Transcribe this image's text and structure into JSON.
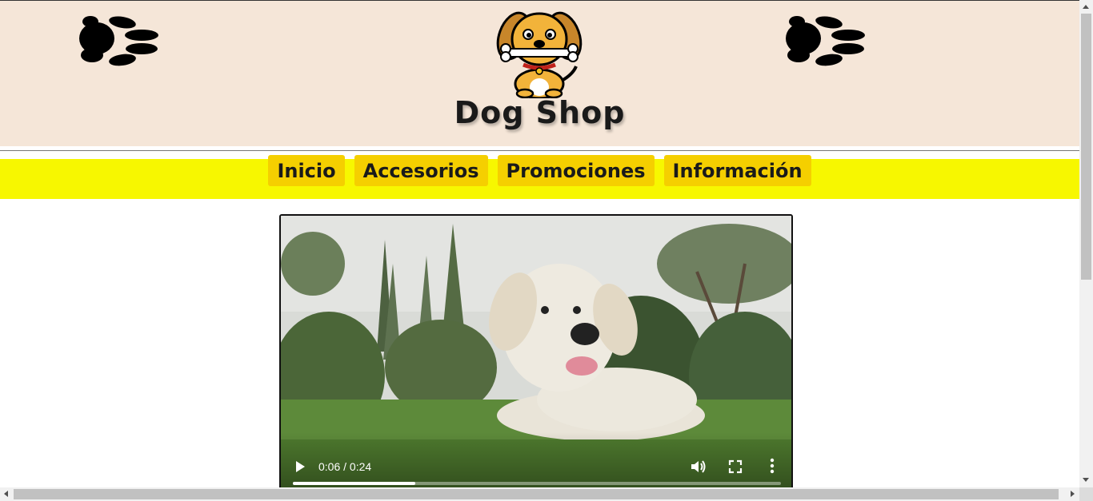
{
  "header": {
    "brand_name": "Dog Shop",
    "background_color": "#f5e6d8",
    "left_decoration": "paw-print-icon",
    "right_decoration": "paw-print-icon",
    "logo": "dog-with-bone-logo"
  },
  "nav": {
    "background_color": "#f7f700",
    "button_color": "#f5cf00",
    "items": [
      {
        "label": "Inicio"
      },
      {
        "label": "Accesorios"
      },
      {
        "label": "Promociones"
      },
      {
        "label": "Información"
      }
    ]
  },
  "video": {
    "current_time": "0:06",
    "duration": "0:24",
    "time_display": "0:06 / 0:24",
    "progress_fraction": 0.25,
    "icons": [
      "play-icon",
      "volume-icon",
      "fullscreen-icon",
      "more-options-icon"
    ]
  }
}
